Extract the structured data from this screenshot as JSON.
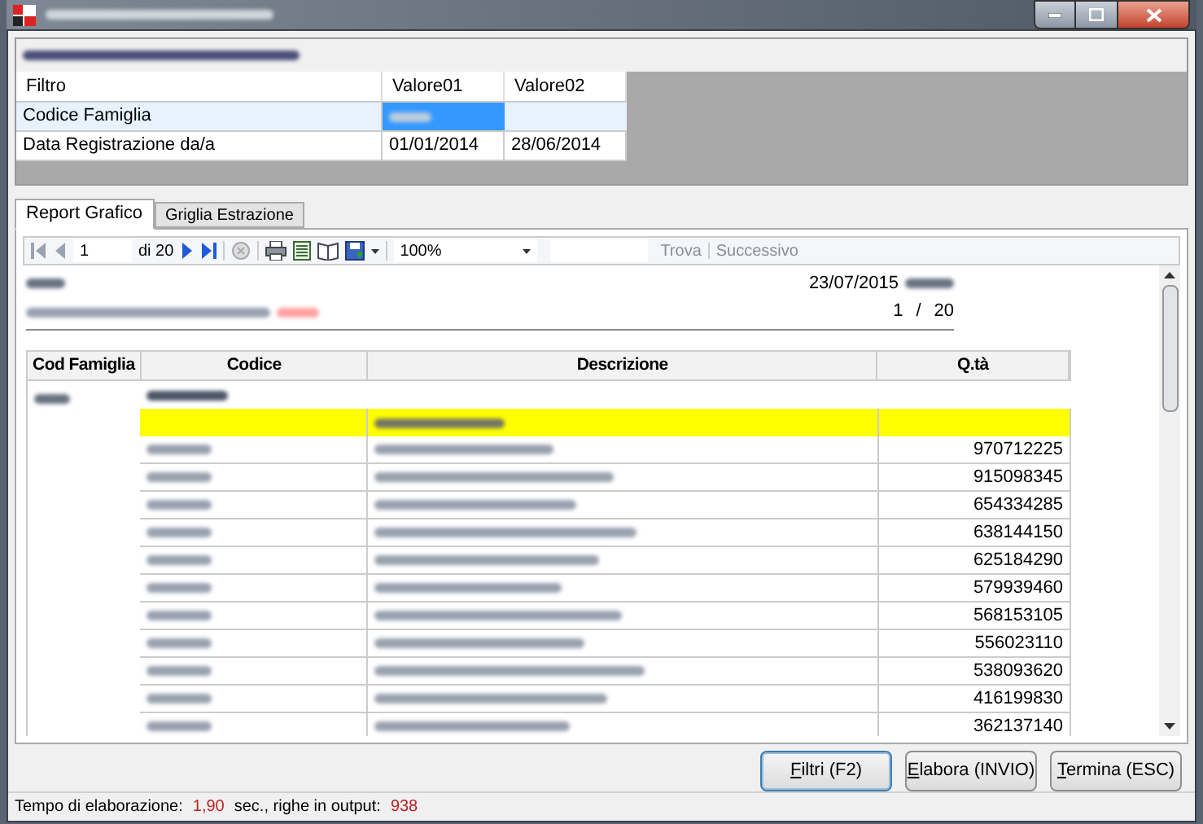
{
  "filter_grid": {
    "columns": [
      "Filtro",
      "Valore01",
      "Valore02"
    ],
    "rows": [
      {
        "label": "Codice Famiglia",
        "selected": true
      },
      {
        "label": "Data Registrazione da/a",
        "selected": false,
        "values": [
          "01/01/2014",
          "28/06/2014"
        ]
      }
    ]
  },
  "tabs": [
    {
      "label": "Report Grafico",
      "selected": true
    },
    {
      "label": "Griglia Estrazione",
      "selected": false
    }
  ],
  "toolbar": {
    "page": "1",
    "of": "di 20",
    "zoom": "100%",
    "find": "Trova",
    "next": "Successivo"
  },
  "report": {
    "date": "23/07/2015",
    "page": "1",
    "separator": "/",
    "pages": "20",
    "columns": [
      "Cod Famiglia",
      "Codice",
      "Descrizione",
      "Q.tà"
    ],
    "quantities": [
      "970712225",
      "915098345",
      "654334285",
      "638144150",
      "625184290",
      "579939460",
      "568153105",
      "556023110",
      "538093620",
      "416199830",
      "362137140"
    ]
  },
  "buttons": [
    {
      "label": "Filtri (F2)",
      "focused": true,
      "mnemonic": true
    },
    {
      "label": "Elabora (INVIO)",
      "focused": false,
      "mnemonic": true
    },
    {
      "label": "Termina (ESC)",
      "focused": false,
      "mnemonic": true
    }
  ],
  "status_bar": {
    "label": "Tempo di elaborazione:",
    "time": "1,90",
    "middle": "sec., righe in output:",
    "rows": "938"
  }
}
